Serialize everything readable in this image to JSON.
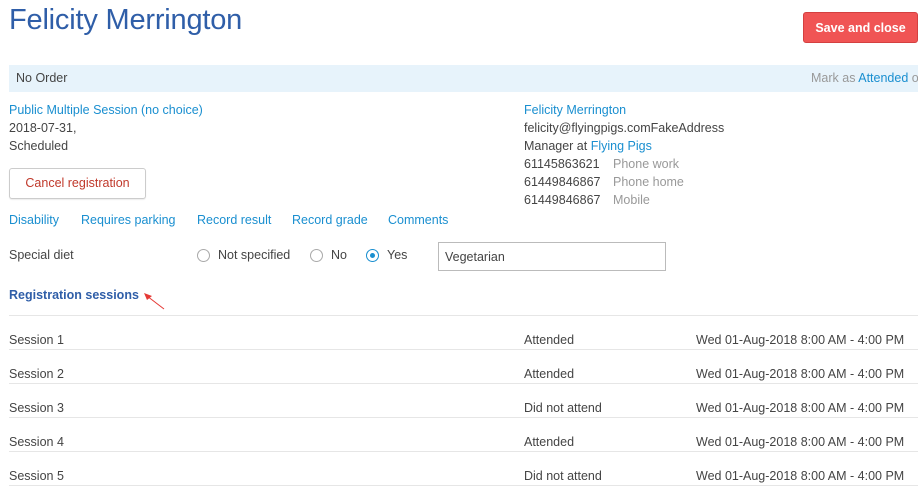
{
  "header": {
    "title": "Felicity Merrington",
    "save_close_label": "Save and close"
  },
  "order_bar": {
    "label": "No Order",
    "mark_as_prefix": "Mark as",
    "mark_as_link": "Attended",
    "mark_as_suffix": "o"
  },
  "event": {
    "name": "Public Multiple Session (no choice)",
    "date": "2018-07-31,",
    "status": "Scheduled",
    "cancel_label": "Cancel registration"
  },
  "contact": {
    "name": "Felicity Merrington",
    "email": "felicity@flyingpigs.comFakeAddress",
    "role_prefix": "Manager at",
    "org": "Flying Pigs",
    "phones": [
      {
        "number": "61145863621",
        "type": "Phone work"
      },
      {
        "number": "61449846867",
        "type": "Phone home"
      },
      {
        "number": "61449846867",
        "type": "Mobile"
      }
    ]
  },
  "links": [
    "Disability",
    "Requires parking",
    "Record result",
    "Record grade",
    "Comments"
  ],
  "special_diet": {
    "label": "Special diet",
    "options": [
      "Not specified",
      "No",
      "Yes"
    ],
    "selected": "Yes",
    "value": "Vegetarian"
  },
  "sessions": {
    "heading": "Registration sessions",
    "rows": [
      {
        "name": "Session 1",
        "status": "Attended",
        "time": "Wed 01-Aug-2018 8:00 AM - 4:00 PM"
      },
      {
        "name": "Session 2",
        "status": "Attended",
        "time": "Wed 01-Aug-2018 8:00 AM - 4:00 PM"
      },
      {
        "name": "Session 3",
        "status": "Did not attend",
        "time": "Wed 01-Aug-2018 8:00 AM - 4:00 PM"
      },
      {
        "name": "Session 4",
        "status": "Attended",
        "time": "Wed 01-Aug-2018 8:00 AM - 4:00 PM"
      },
      {
        "name": "Session 5",
        "status": "Did not attend",
        "time": "Wed 01-Aug-2018 8:00 AM - 4:00 PM"
      }
    ]
  },
  "colors": {
    "accent": "#1a8fd0",
    "title": "#2f5ea8",
    "danger": "#f05454",
    "bar": "#e7f3fb"
  }
}
